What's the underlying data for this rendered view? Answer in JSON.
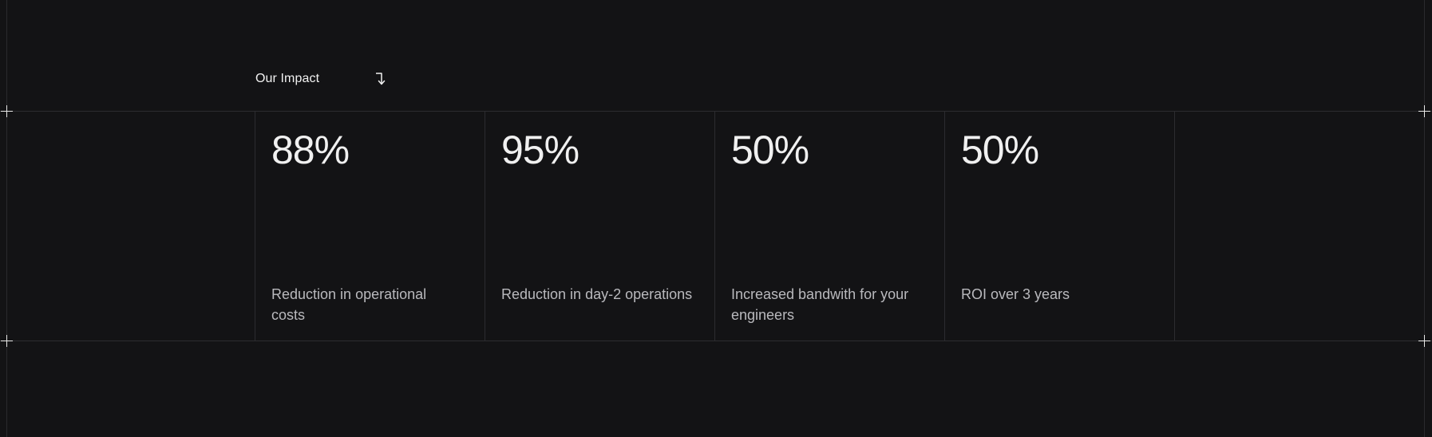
{
  "section": {
    "label": "Our Impact",
    "icon": "arrow-down-right-icon"
  },
  "stats": [
    {
      "value": "88%",
      "description": "Reduction in operational costs"
    },
    {
      "value": "95%",
      "description": "Reduction in day-2 operations"
    },
    {
      "value": "50%",
      "description": "Increased bandwith for your engineers"
    },
    {
      "value": "50%",
      "description": "ROI over 3 years"
    }
  ],
  "colors": {
    "background": "#131315",
    "grid_line": "#2c2c30",
    "value_text": "#f0f0f0",
    "description_text": "#b9b9bd"
  }
}
